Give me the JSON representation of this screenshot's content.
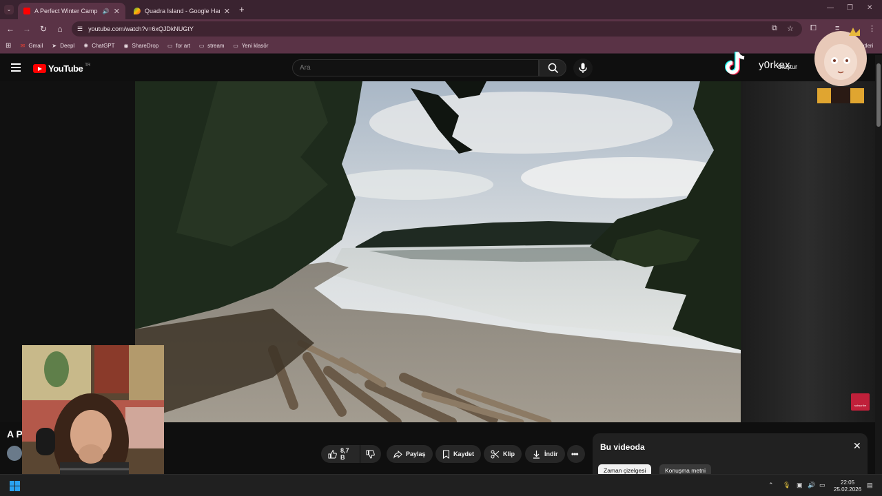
{
  "browser": {
    "tabs": [
      {
        "title": "A Perfect Winter Camp - Yo",
        "active": true
      },
      {
        "title": "Quadra Island - Google Harita",
        "active": false
      }
    ],
    "new_tab": "+",
    "url": "youtube.com/watch?v=6xQJDkNUGtY",
    "bookmarks": [
      {
        "label": "Gmail",
        "icon": "gmail-icon"
      },
      {
        "label": "Deepl",
        "icon": "deepl-icon"
      },
      {
        "label": "ChatGPT",
        "icon": "chatgpt-icon"
      },
      {
        "label": "ShareDrop",
        "icon": "sharedrop-icon"
      },
      {
        "label": "for art",
        "icon": "folder-icon"
      },
      {
        "label": "stream",
        "icon": "folder-icon"
      },
      {
        "label": "Yeni klasör",
        "icon": "folder-icon"
      }
    ],
    "other_bookmarks_partial": "etleri"
  },
  "youtube": {
    "logo": "YouTube",
    "logo_region": "TR",
    "search_placeholder": "Ara",
    "create_label": "Oluştur",
    "video_title_partial": "A P",
    "actions": {
      "likes": "8,7 B",
      "share": "Paylaş",
      "save": "Kaydet",
      "clip": "Klip",
      "download": "İndir"
    },
    "in_this_video": {
      "title": "Bu videoda",
      "chips": [
        "Zaman çizelgesi",
        "Konuşma metni"
      ]
    },
    "subscribe_badge": "subscribe"
  },
  "overlay": {
    "handle": "y0rkex"
  },
  "taskbar": {
    "time": "22:05",
    "date": "25.02.2026"
  }
}
